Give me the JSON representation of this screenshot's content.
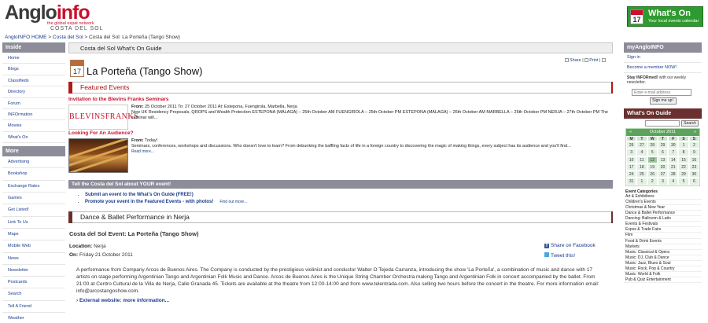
{
  "header": {
    "logo_part1": "Anglo",
    "logo_part2": "info",
    "logo_tagline": "the global expat network",
    "logo_region": "COSTA DEL SOL",
    "whats_on_title": "What's On",
    "whats_on_subtitle": "Your local events calendar",
    "whats_on_cal_day": "17"
  },
  "breadcrumb": {
    "home": "AngloINFO HOME",
    "sep": ">",
    "section": "Costa del Sol",
    "current": "Costa del Sol: La Porteña (Tango Show)"
  },
  "left_nav": {
    "inside_title": "Inside",
    "inside_items": [
      "Home",
      "Blogs",
      "Classifieds",
      "Directory",
      "Forum",
      "INFOrmation",
      "Movies",
      "What's On"
    ],
    "more_title": "More",
    "more_items": [
      "Advertising",
      "Bookshop",
      "Exchange Rates",
      "Games",
      "Get Listed!",
      "Link To Us",
      "Maps",
      "Mobile Web",
      "News",
      "Newsletter",
      "Postcards",
      "Search",
      "Tell A Friend",
      "Weather",
      "(AngloINFO Spain)"
    ]
  },
  "main": {
    "guide_title": "Costa del Sol What's On Guide",
    "cal_icon_day": "17",
    "page_title": "La Porteña (Tango Show)",
    "share_label": "Share",
    "print_label": "Print",
    "featured_title": "Featured Events",
    "event1": {
      "title": "Invitation to the Blevins Franks Seminars",
      "image_text": "BLEVINSFRANKS",
      "date_label": "From:",
      "date_text": "25 October 2011 To: 27 October 2011 At: Estepona, Fuengirola, Marbella, Nerja",
      "desc": "New UK Residency Proposals, QROPS and Wealth Protection     ESTEPONA (MÁLAGA) – 25th October AM FUENGIROLA – 25th October PM ESTEPONA (MÁLAGA) – 26th October AM MARBELLA – 26th October PM NERJA – 27th October PM   The seminar will...",
      "read_more": "Read more..."
    },
    "event2": {
      "title": "Looking For An Audience?",
      "date_label": "From:",
      "date_text": "Today!",
      "desc": "Seminars, conferences, workshops and discussions. Who doesn't love to learn? From debunking the baffling facts of life in a foreign country to discovering the magic of making things, every subject has its audience and you'll find...",
      "read_more": "Read more..."
    },
    "tell_title": "Tell the Costa del Sol about YOUR event!",
    "tell_item1": "Submit an event to the What's On Guide (FREE!)",
    "tell_item2": "Promote your event in the Featured Events - with photos!",
    "find_out": "Find out more...",
    "category_title": "Dance & Ballet Performance in Nerja",
    "event_name": "Costa del Sol Event: La Porteña (Tango Show)",
    "location_label": "Location:",
    "location_value": "Nerja",
    "on_label": "On:",
    "on_value": "Friday 21 October 2011",
    "share_facebook": "Share on Facebook",
    "tweet": "Tweet this!",
    "description": "A performance from Company Arcos de Buenos Aires. The Company is conducted by the prestigious violinist and conductor Walter O Tejeda Carranza, introducing the show 'La Porteña', a combination of music and dance with 17 artists on stage performing Argentinian Tango and Argentinian Folk Music and Dance. Arcos de Buenos Aires is the Unique String Chamber Orchestra making Tango and Argentinian Folk in concert accompanied by the ballet. From 21:00 at Centro Cultural de la Villa de Nerja, Calle Granada 45. Tickets are available at the theatre from 12:00-14:00 and from www.telentrada.com. Also selling two hours before the concert in the theatre. For more information email: info@arcostangoshow.com.",
    "external_link": "› External website: more information..."
  },
  "right": {
    "my_title": "myAngloINFO",
    "sign_in": "Sign in",
    "become_member": "Become a member NOW!",
    "newsletter_bold": "Stay INFORmed!",
    "newsletter_text": " with our weekly newsletter.",
    "email_placeholder": "Enter e-mail address",
    "signup_button": "Sign me up!",
    "whats_on_guide": "What's On Guide",
    "search_button": "Search",
    "cal_prev": "«",
    "cal_month": "October 2011",
    "cal_next": "»",
    "cal_weekdays": [
      "M",
      "T",
      "W",
      "T",
      "F",
      "S",
      "S"
    ],
    "cal_days": [
      "26",
      "27",
      "28",
      "29",
      "30",
      "1",
      "2",
      "3",
      "4",
      "5",
      "6",
      "7",
      "8",
      "9",
      "10",
      "11",
      "12",
      "13",
      "14",
      "15",
      "16",
      "17",
      "18",
      "19",
      "20",
      "21",
      "22",
      "23",
      "24",
      "25",
      "26",
      "27",
      "28",
      "29",
      "30",
      "31",
      "1",
      "2",
      "3",
      "4",
      "5",
      "6"
    ],
    "cal_today_index": 16,
    "categories_title": "Event Categories",
    "categories": [
      "Art & Exhibitions",
      "Children's Events",
      "Christmas & New Year",
      "Dance & Ballet Performance",
      "Dancing: Ballroom & Latin",
      "Events & Festivals",
      "Expos & Trade Fairs",
      "Film",
      "Food & Drink Events",
      "Markets",
      "Music: Classical & Opera",
      "Music: DJ, Club & Dance",
      "Music: Jazz, Blues & Soul",
      "Music: Rock, Pop & Country",
      "Music: World & Folk",
      "Pub & Quiz Entertainment"
    ]
  }
}
